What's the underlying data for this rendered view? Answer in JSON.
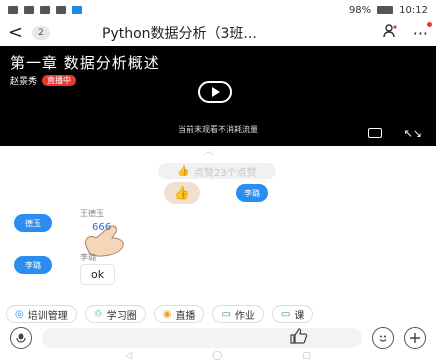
{
  "status_bar": {
    "left_icons": [
      "sim-icon",
      "signal-icon",
      "wifi-icon",
      "notification-icon",
      "message-icon"
    ],
    "battery": "98%",
    "time": "10:12"
  },
  "nav": {
    "back_label": "<",
    "unread_count": "2",
    "title": "Python数据分析（3班..."
  },
  "video": {
    "title": "第一章  数据分析概述",
    "author": "赵景秀",
    "live_badge": "直播中",
    "hint": "当前未观看不消耗流量"
  },
  "chat": {
    "praise_text": "点赞23个点赞",
    "messages": [
      {
        "avatar": "李璐",
        "name": "",
        "type": "sticker"
      },
      {
        "avatar": "德玉",
        "name": "王德玉",
        "sticker_text": "666",
        "type": "sticker"
      },
      {
        "avatar": "李璐",
        "name": "李璐",
        "text": "ok",
        "type": "text"
      }
    ]
  },
  "tools": [
    {
      "label": "培训管理",
      "icon": "target-icon",
      "color": "#2b8df0"
    },
    {
      "label": "学习圈",
      "icon": "recycle-icon",
      "color": "#2ea44f"
    },
    {
      "label": "直播",
      "icon": "live-icon",
      "color": "#f0a020"
    },
    {
      "label": "作业",
      "icon": "homework-icon",
      "color": "#2ea44f"
    },
    {
      "label": "课",
      "icon": "course-icon",
      "color": "#2ea44f"
    }
  ],
  "input": {
    "placeholder": ""
  },
  "android_nav": [
    "◁",
    "◯",
    "▢"
  ]
}
